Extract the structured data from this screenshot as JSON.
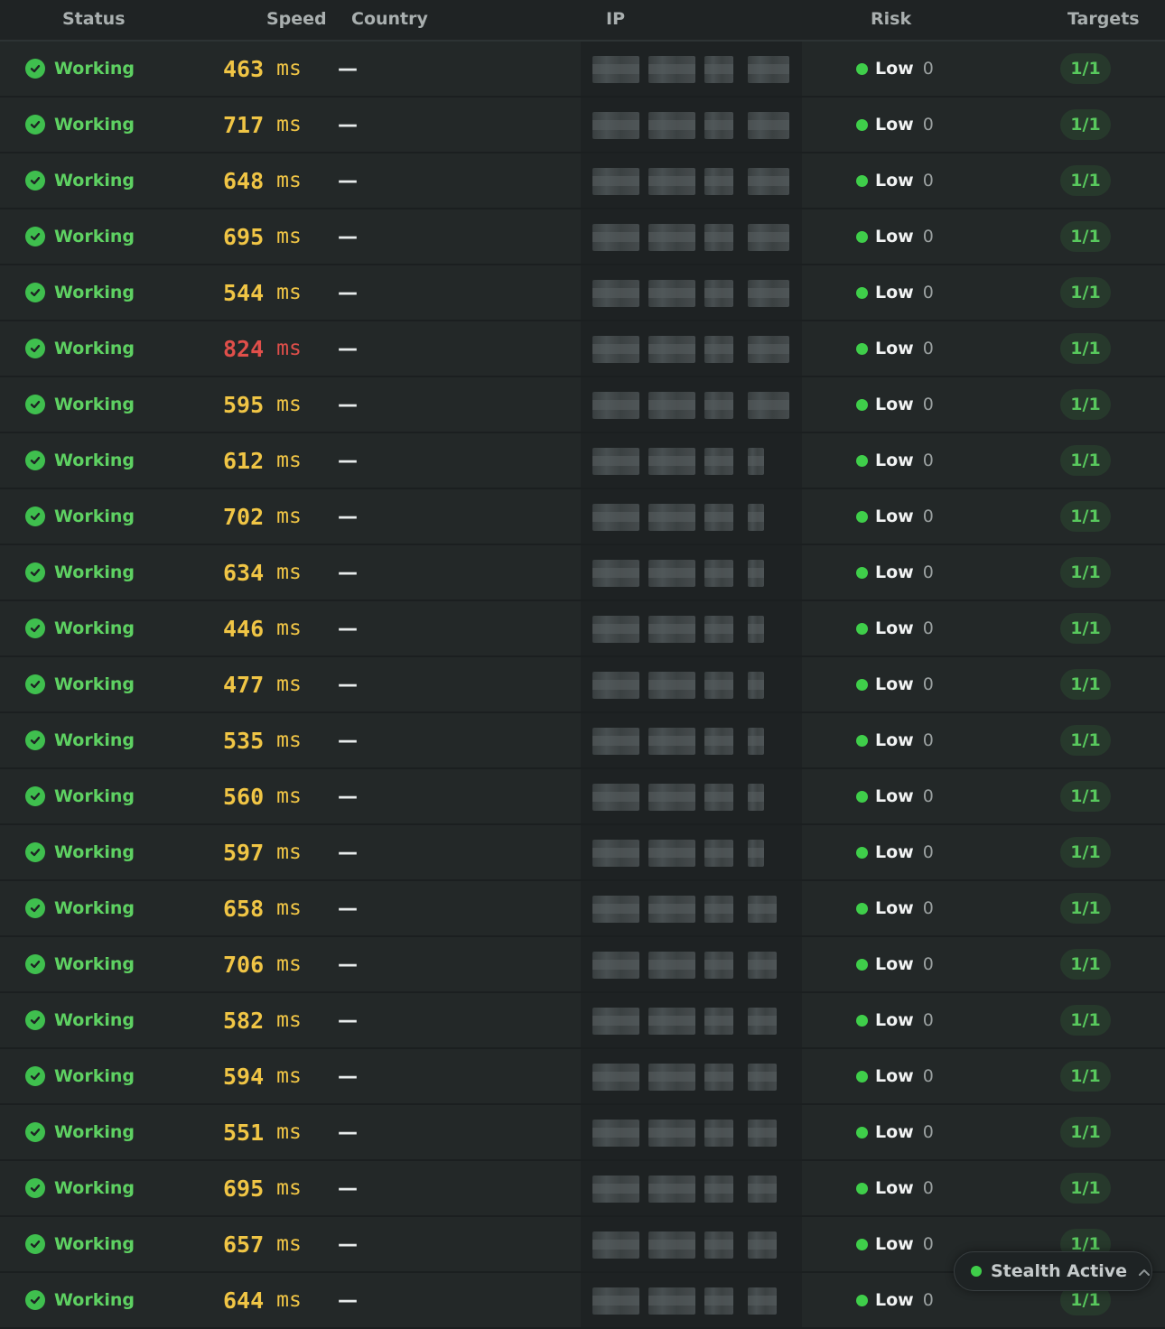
{
  "header": {
    "status": "Status",
    "speed": "Speed",
    "country": "Country",
    "ip": "IP",
    "risk": "Risk",
    "targets": "Targets"
  },
  "status_label": "Working",
  "speed_unit": "ms",
  "country_placeholder": "—",
  "risk_label": "Low",
  "risk_score": "0",
  "targets_value": "1/1",
  "colors": {
    "ok_green": "#5ed162",
    "speed_yellow": "#f0c545",
    "speed_red": "#e04f4a"
  },
  "rows": [
    {
      "speed": "463",
      "slow": false
    },
    {
      "speed": "717",
      "slow": false
    },
    {
      "speed": "648",
      "slow": false
    },
    {
      "speed": "695",
      "slow": false
    },
    {
      "speed": "544",
      "slow": false
    },
    {
      "speed": "824",
      "slow": true
    },
    {
      "speed": "595",
      "slow": false
    },
    {
      "speed": "612",
      "slow": false
    },
    {
      "speed": "702",
      "slow": false
    },
    {
      "speed": "634",
      "slow": false
    },
    {
      "speed": "446",
      "slow": false
    },
    {
      "speed": "477",
      "slow": false
    },
    {
      "speed": "535",
      "slow": false
    },
    {
      "speed": "560",
      "slow": false
    },
    {
      "speed": "597",
      "slow": false
    },
    {
      "speed": "658",
      "slow": false
    },
    {
      "speed": "706",
      "slow": false
    },
    {
      "speed": "582",
      "slow": false
    },
    {
      "speed": "594",
      "slow": false
    },
    {
      "speed": "551",
      "slow": false
    },
    {
      "speed": "695",
      "slow": false
    },
    {
      "speed": "657",
      "slow": false
    },
    {
      "speed": "644",
      "slow": false
    }
  ],
  "stealth": {
    "label": "Stealth Active",
    "icon": "chevron-up-icon"
  }
}
